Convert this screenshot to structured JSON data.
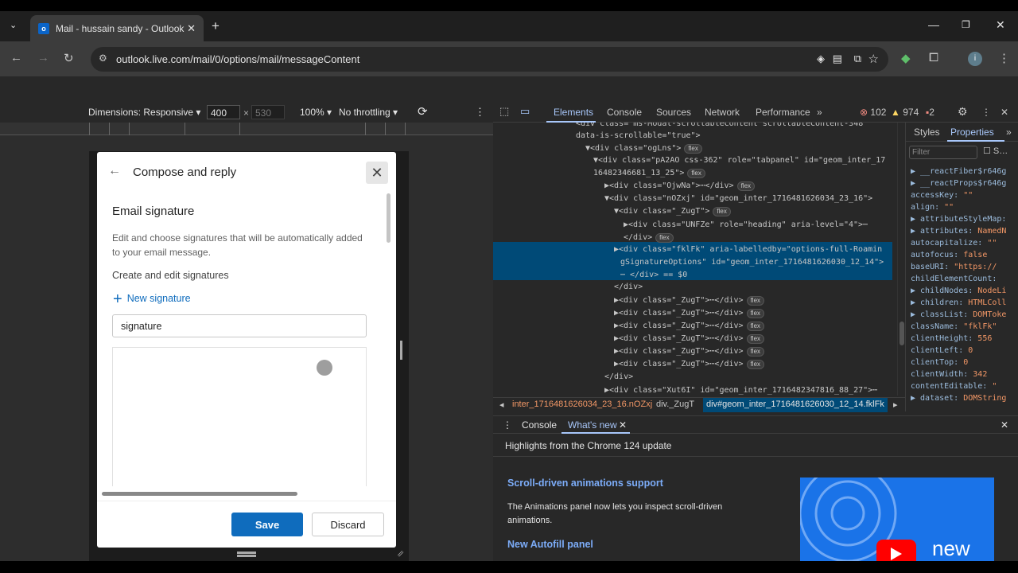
{
  "browser": {
    "tab_title": "Mail - hussain sandy - Outlook",
    "tab_favicon": "o",
    "url": "outlook.live.com/mail/0/options/mail/messageContent",
    "profile_initial": "i"
  },
  "device_toolbar": {
    "dimensions_label": "Dimensions: Responsive",
    "width": "400",
    "height": "530",
    "zoom": "100%",
    "throttling": "No throttling"
  },
  "dialog": {
    "title": "Compose and reply",
    "section_title": "Email signature",
    "description": "Edit and choose signatures that will be automatically added to your email message.",
    "create_label": "Create and edit signatures",
    "new_signature": "New signature",
    "signature_name_value": "signature",
    "save_label": "Save",
    "discard_label": "Discard"
  },
  "devtools": {
    "tabs": [
      "Elements",
      "Console",
      "Sources",
      "Network",
      "Performance"
    ],
    "errors": "102",
    "warnings": "974",
    "issues": "2",
    "elements_lines": [
      {
        "indent": 0,
        "text": "<div class=\"ms-Modal-scrollableContent scrollableContent-348\""
      },
      {
        "indent": 0,
        "text": "data-is-scrollable=\"true\">"
      },
      {
        "indent": 1,
        "text": "▼<div class=\"ogLns\">",
        "badge": "flex"
      },
      {
        "indent": 2,
        "text": "▼<div class=\"pA2AO css-362\" role=\"tabpanel\" id=\"geom_inter_17"
      },
      {
        "indent": 2,
        "text": " 16482346681_13_25\">",
        "badge": "flex"
      },
      {
        "indent": 3,
        "text": "▶<div class=\"OjwNa\">⋯</div>",
        "badge": "flex"
      },
      {
        "indent": 3,
        "text": "▼<div class=\"nOZxj\" id=\"geom_inter_1716481626034_23_16\">"
      },
      {
        "indent": 4,
        "text": "▼<div class=\"_ZugT\">",
        "badge": "flex"
      },
      {
        "indent": 5,
        "text": "▶<div class=\"UNFZe\" role=\"heading\" aria-level=\"4\">⋯"
      },
      {
        "indent": 5,
        "text": " </div>",
        "badge": "flex"
      },
      {
        "indent": 5,
        "text": "▶<div class=\"fklFk\" aria-labelledby=\"options-full-Roamin"
      },
      {
        "indent": 5,
        "text": " gSignatureOptions\" id=\"geom_inter_1716481626030_12_14\">"
      },
      {
        "indent": 5,
        "text": " ⋯ </div> == $0"
      },
      {
        "indent": 4,
        "text": " </div>"
      },
      {
        "indent": 4,
        "text": "▶<div class=\"_ZugT\">⋯</div>",
        "badge": "flex"
      },
      {
        "indent": 4,
        "text": "▶<div class=\"_ZugT\">⋯</div>",
        "badge": "flex"
      },
      {
        "indent": 4,
        "text": "▶<div class=\"_ZugT\">⋯</div>",
        "badge": "flex"
      },
      {
        "indent": 4,
        "text": "▶<div class=\"_ZugT\">⋯</div>",
        "badge": "flex"
      },
      {
        "indent": 4,
        "text": "▶<div class=\"_ZugT\">⋯</div>",
        "badge": "flex"
      },
      {
        "indent": 4,
        "text": "▶<div class=\"_ZugT\">⋯</div>",
        "badge": "flex"
      },
      {
        "indent": 3,
        "text": " </div>"
      },
      {
        "indent": 3,
        "text": "▶<div class=\"Xut6I\" id=\"geom_inter_1716482347816_88_27\">⋯"
      }
    ],
    "breadcrumbs": [
      "inter_1716481626034_23_16.nOZxj",
      "div._ZugT",
      "div#geom_inter_1716481626030_12_14.fklFk"
    ],
    "side_tabs": [
      "Styles",
      "Properties"
    ],
    "filter_placeholder": "Filter",
    "show_all_label": "S…",
    "properties": [
      {
        "key": "▶ __reactFiber$r646g",
        "val": ""
      },
      {
        "key": "▶ __reactProps$r646g",
        "val": ""
      },
      {
        "key": "  accessKey: ",
        "val": "\"\""
      },
      {
        "key": "  align: ",
        "val": "\"\""
      },
      {
        "key": "▶ attributeStyleMap: ",
        "val": ""
      },
      {
        "key": "▶ attributes: ",
        "val": "NamedN"
      },
      {
        "key": "  autocapitalize: ",
        "val": "\"\""
      },
      {
        "key": "  autofocus: ",
        "val": "false"
      },
      {
        "key": "  baseURI: ",
        "val": "\"https://"
      },
      {
        "key": "  childElementCount: ",
        "val": ""
      },
      {
        "key": "▶ childNodes: ",
        "val": "NodeLi"
      },
      {
        "key": "▶ children: ",
        "val": "HTMLColl"
      },
      {
        "key": "▶ classList: ",
        "val": "DOMToke"
      },
      {
        "key": "  className: ",
        "val": "\"fklFk\""
      },
      {
        "key": "  clientHeight: ",
        "val": "556"
      },
      {
        "key": "  clientLeft: ",
        "val": "0"
      },
      {
        "key": "  clientTop: ",
        "val": "0"
      },
      {
        "key": "  clientWidth: ",
        "val": "342"
      },
      {
        "key": "  contentEditable: ",
        "val": "\""
      },
      {
        "key": "▶ dataset: ",
        "val": "DOMString"
      }
    ],
    "drawer_tabs": [
      "Console",
      "What's new"
    ],
    "whats_new": {
      "title": "Highlights from the Chrome 124 update",
      "h1": "Scroll-driven animations support",
      "p1": "The Animations panel now lets you inspect scroll-driven animations.",
      "h2": "New Autofill panel",
      "thumb_text": "new"
    }
  }
}
